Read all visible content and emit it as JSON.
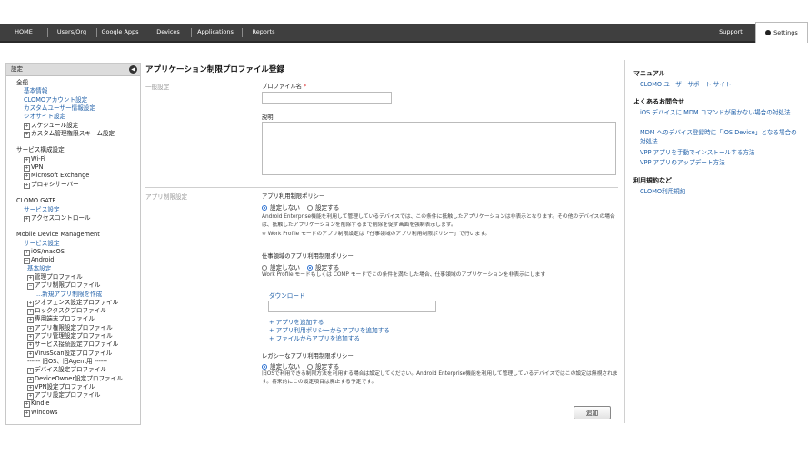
{
  "nav": {
    "items": [
      "HOME",
      "Users/Org",
      "Google Apps",
      "Devices",
      "Applications",
      "Reports"
    ],
    "support": "Support",
    "settings": "Settings"
  },
  "sidebar": {
    "header": "設定",
    "tree": [
      {
        "text": "全般",
        "link": false,
        "indent": 0,
        "pm": ""
      },
      {
        "text": "基本情報",
        "link": true,
        "indent": 1,
        "pm": ""
      },
      {
        "text": "CLOMOアカウント設定",
        "link": true,
        "indent": 1,
        "pm": ""
      },
      {
        "text": "カスタムユーザー情報設定",
        "link": true,
        "indent": 1,
        "pm": ""
      },
      {
        "text": "ジオサイト設定",
        "link": true,
        "indent": 1,
        "pm": ""
      },
      {
        "text": "スケジュール設定",
        "link": false,
        "indent": 1,
        "pm": "+"
      },
      {
        "text": "カスタム管理権限スキーム設定",
        "link": false,
        "indent": 1,
        "pm": "+"
      },
      {
        "text": "",
        "link": false,
        "indent": 0,
        "pm": ""
      },
      {
        "text": "サービス構成設定",
        "link": false,
        "indent": 0,
        "pm": ""
      },
      {
        "text": "Wi-Fi",
        "link": false,
        "indent": 1,
        "pm": "+"
      },
      {
        "text": "VPN",
        "link": false,
        "indent": 1,
        "pm": "+"
      },
      {
        "text": "Microsoft Exchange",
        "link": false,
        "indent": 1,
        "pm": "+"
      },
      {
        "text": "プロキシサーバー",
        "link": false,
        "indent": 1,
        "pm": "+"
      },
      {
        "text": "",
        "link": false,
        "indent": 0,
        "pm": ""
      },
      {
        "text": "CLOMO GATE",
        "link": false,
        "indent": 0,
        "pm": ""
      },
      {
        "text": "サービス設定",
        "link": true,
        "indent": 1,
        "pm": ""
      },
      {
        "text": "アクセスコントロール",
        "link": false,
        "indent": 1,
        "pm": "+"
      },
      {
        "text": "",
        "link": false,
        "indent": 0,
        "pm": ""
      },
      {
        "text": "Mobile Device Management",
        "link": false,
        "indent": 0,
        "pm": ""
      },
      {
        "text": "サービス設定",
        "link": true,
        "indent": 1,
        "pm": ""
      },
      {
        "text": "iOS/macOS",
        "link": false,
        "indent": 1,
        "pm": "+"
      },
      {
        "text": "Android",
        "link": false,
        "indent": 1,
        "pm": "-"
      },
      {
        "text": "基本設定",
        "link": true,
        "indent": 2,
        "pm": ""
      },
      {
        "text": "管理プロファイル",
        "link": false,
        "indent": 2,
        "pm": "+"
      },
      {
        "text": "アプリ制限プロファイル",
        "link": false,
        "indent": 2,
        "pm": "-"
      },
      {
        "text": "...新規アプリ制限を作成",
        "link": true,
        "indent": 3,
        "pm": ""
      },
      {
        "text": "ジオフェンス設定プロファイル",
        "link": false,
        "indent": 2,
        "pm": "+"
      },
      {
        "text": "ロックタスクプロファイル",
        "link": false,
        "indent": 2,
        "pm": "+"
      },
      {
        "text": "専用端末プロファイル",
        "link": false,
        "indent": 2,
        "pm": "+"
      },
      {
        "text": "アプリ権限設定プロファイル",
        "link": false,
        "indent": 2,
        "pm": "+"
      },
      {
        "text": "アプリ管理設定プロファイル",
        "link": false,
        "indent": 2,
        "pm": "+"
      },
      {
        "text": "サービス接続設定プロファイル",
        "link": false,
        "indent": 2,
        "pm": "+"
      },
      {
        "text": "VirusScan設定プロファイル",
        "link": false,
        "indent": 2,
        "pm": "+"
      },
      {
        "text": "------ 旧OS、旧Agent用 ------",
        "link": false,
        "indent": 2,
        "pm": ""
      },
      {
        "text": "デバイス設定プロファイル",
        "link": false,
        "indent": 2,
        "pm": "+"
      },
      {
        "text": "DeviceOwner設定プロファイル",
        "link": false,
        "indent": 2,
        "pm": "+"
      },
      {
        "text": "VPN設定プロファイル",
        "link": false,
        "indent": 2,
        "pm": "+"
      },
      {
        "text": "アプリ設定プロファイル",
        "link": false,
        "indent": 2,
        "pm": "+"
      },
      {
        "text": "Kindle",
        "link": false,
        "indent": 1,
        "pm": "+"
      },
      {
        "text": "Windows",
        "link": false,
        "indent": 1,
        "pm": "+"
      }
    ]
  },
  "main": {
    "title": "アプリケーション制限プロファイル登録",
    "general_label": "一般設定",
    "profile_name_label": "プロファイル名",
    "required_mark": "*",
    "profile_name_value": "",
    "description_label": "説明",
    "description_value": "",
    "app_section_label": "アプリ制限設定",
    "policy": {
      "label": "アプリ利用制限ポリシー",
      "opt_off": "設定しない",
      "opt_on": "設定する",
      "selected": "off",
      "note1": "Android Enterprise機能を利用して管理しているデバイスでは、この条件に抵触したアプリケーションは非表示となります。その他のデバイスの場合は、抵触したアプリケーションを削除するまで削除を促す画面を強制表示します。",
      "note2": "※ Work Profile モードのアプリ制限設定は「仕事領域のアプリ利用制限ポリシー」で行います。"
    },
    "work_policy": {
      "label": "仕事領域のアプリ利用制限ポリシー",
      "opt_off": "設定しない",
      "opt_on": "設定する",
      "selected": "on",
      "note": "Work Profile モードもしくは COMP モードでこの条件を満たした場合、仕事領域のアプリケーションを非表示にします",
      "list_title": "ダウンロード",
      "search_value": "",
      "add_app": "+ アプリを追加する",
      "add_from_policy": "+ アプリ利用ポリシーからアプリを追加する",
      "add_from_file": "+ ファイルからアプリを追加する"
    },
    "legacy_policy": {
      "label": "レガシーなアプリ利用制限ポリシー",
      "opt_off": "設定しない",
      "opt_on": "設定する",
      "selected": "off",
      "note": "旧OSで利用できる制限方法を利用する場合は設定してください。Android Enterprise機能を利用して管理しているデバイスではこの設定は無視されます。将来的にこの設定項目は廃止する予定です。"
    },
    "add_button": "追加"
  },
  "right": {
    "manual_title": "マニュアル",
    "manual_link": "CLOMO ユーザーサポート サイト",
    "faq_title": "よくあるお問合せ",
    "faq_links": [
      "iOS デバイスに MDM コマンドが届かない場合の対処法",
      "MDM へのデバイス登録時に「iOS Device」となる場合の対処法",
      "VPP アプリを手動でインストールする方法",
      "VPP アプリのアップデート方法"
    ],
    "terms_title": "利用規約など",
    "terms_link": "CLOMO利用規約"
  }
}
